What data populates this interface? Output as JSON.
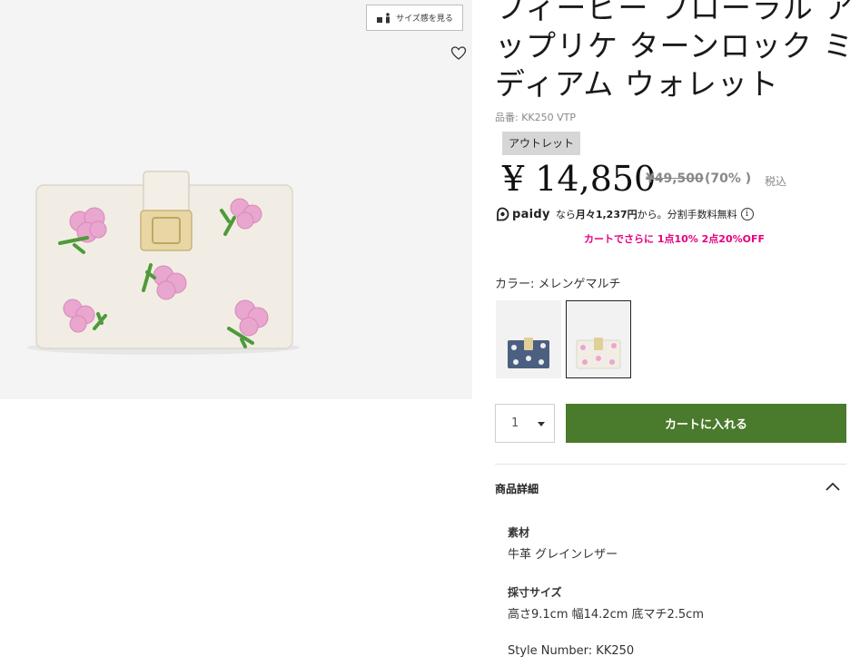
{
  "gallery": {
    "size_button_label": "サイズ感を見る"
  },
  "product": {
    "title": "フィービー フローラル アップリケ ターンロック ミディアム ウォレット",
    "sku_label": "品番",
    "sku": "KK250 VTP",
    "badge": "アウトレット",
    "price": "¥ 14,850",
    "original_price": "¥49,500",
    "discount": "(70% )",
    "tax": "税込"
  },
  "payment": {
    "provider": "paidy",
    "text_before": "なら",
    "monthly": "月々1,237円",
    "text_after": "から。分割手数料無料"
  },
  "promo": "カートでさらに 1点10% 2点20%OFF",
  "color": {
    "label": "カラー:",
    "selected": "メレンゲマルチ",
    "swatches": [
      {
        "name": "navy-multi",
        "bg": "#4b5f80"
      },
      {
        "name": "meringue-multi",
        "bg": "#f1ede4"
      }
    ]
  },
  "cart": {
    "quantity": "1",
    "add_to_cart": "カートに入れる"
  },
  "details": {
    "heading": "商品詳細",
    "material_label": "素材",
    "material": "牛革 グレインレザー",
    "size_label": "採寸サイズ",
    "size": "高さ9.1cm 幅14.2cm 底マチ2.5cm",
    "style_number": "Style Number: KK250"
  },
  "colors": {
    "cart_green": "#4a7a2b",
    "promo_pink": "#e4007f"
  }
}
